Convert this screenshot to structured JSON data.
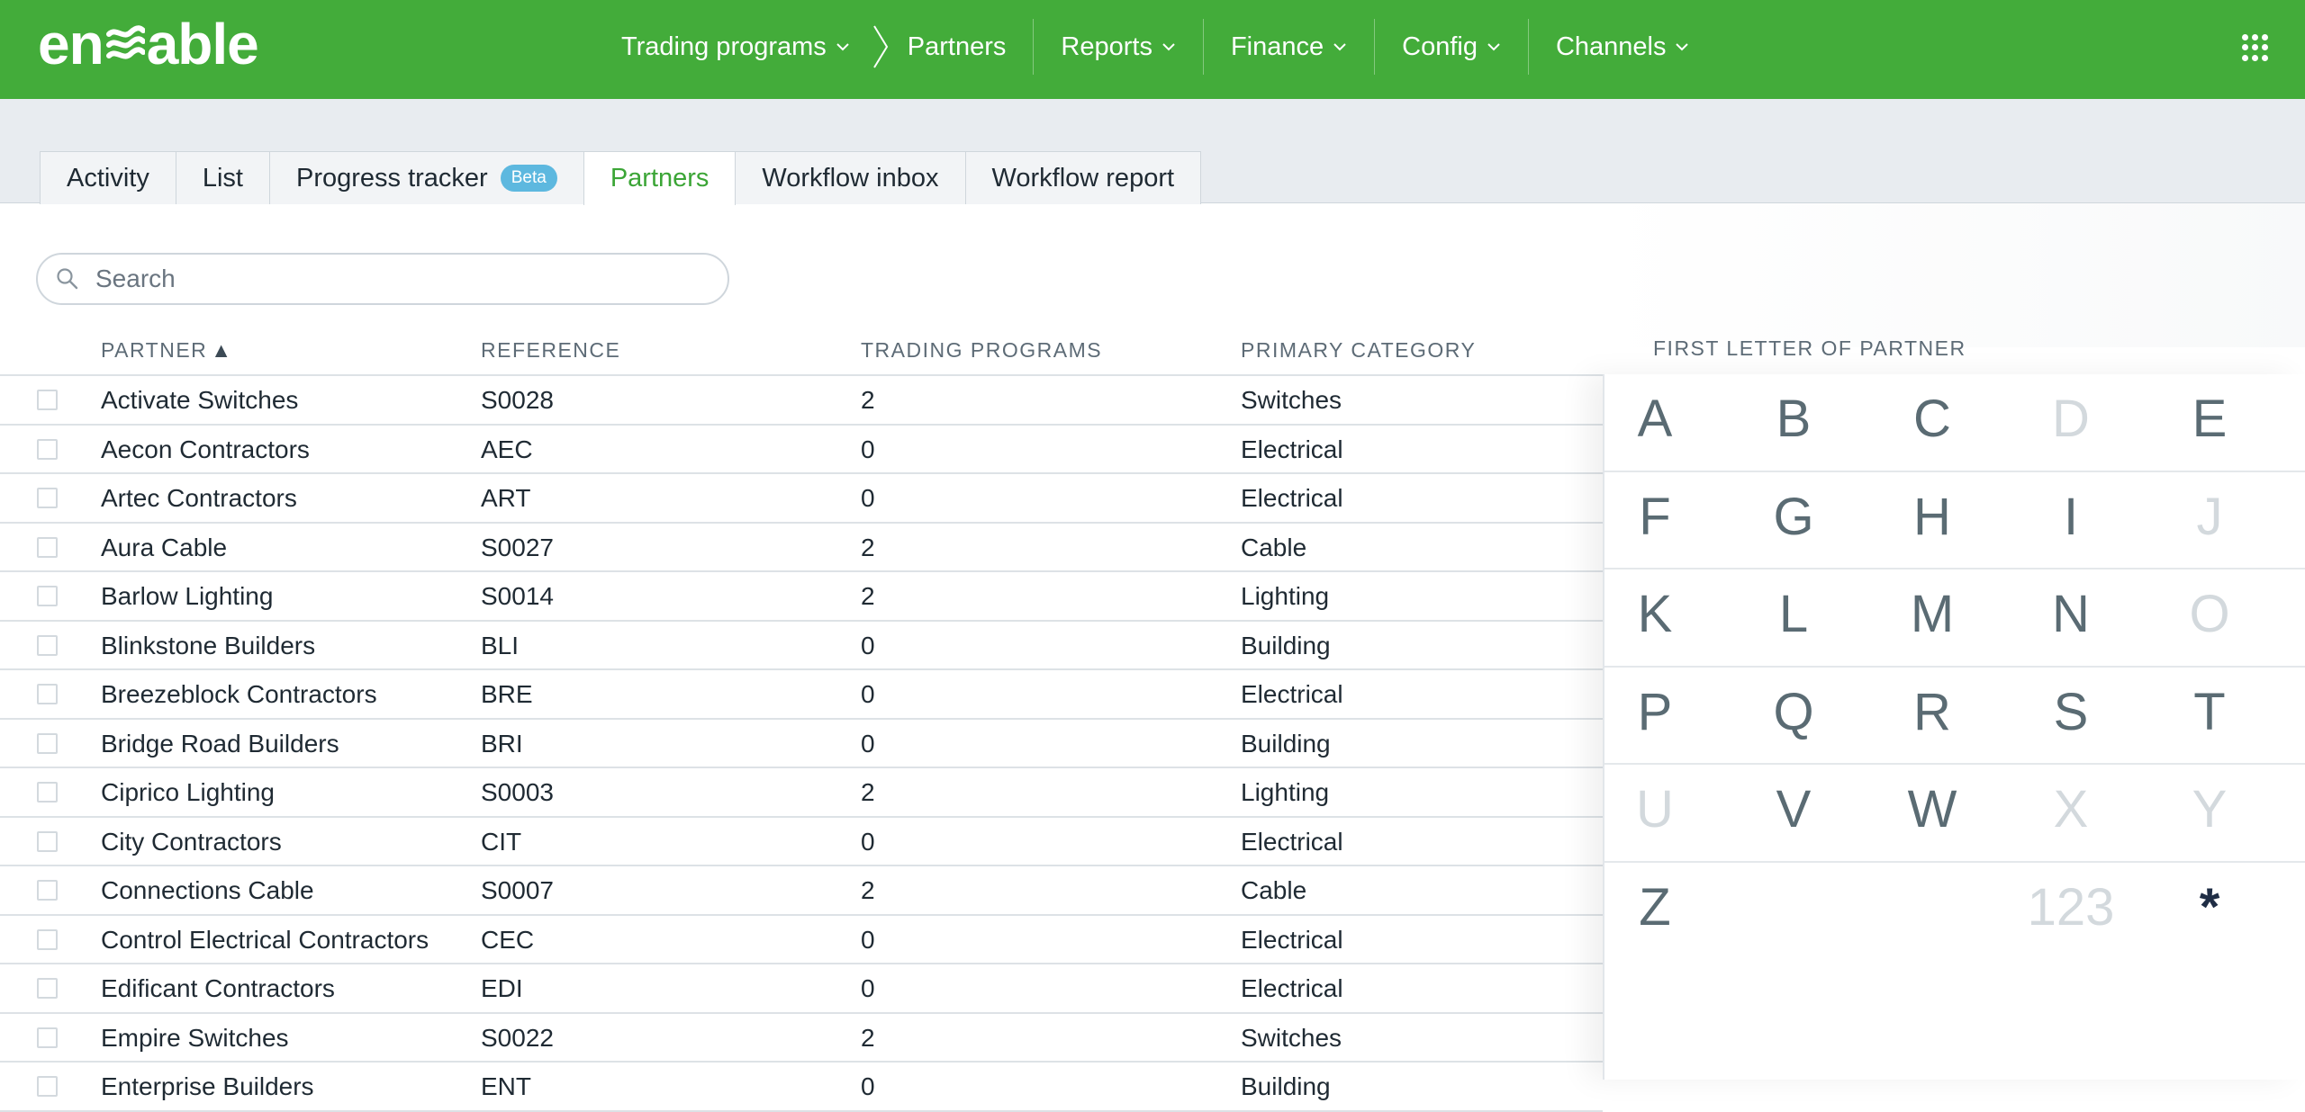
{
  "brand": {
    "logo_text_left": "en",
    "logo_text_right": "able",
    "bar_color": "#43ac3a"
  },
  "topnav": {
    "items": [
      {
        "label": "Trading programs",
        "icon": "chevron-down-icon"
      },
      {
        "label": "Partners",
        "icon": ""
      },
      {
        "label": "Reports",
        "icon": "chevron-down-icon"
      },
      {
        "label": "Finance",
        "icon": "chevron-down-icon"
      },
      {
        "label": "Config",
        "icon": "chevron-down-icon"
      },
      {
        "label": "Channels",
        "icon": "chevron-down-icon"
      }
    ],
    "apps_icon": "apps-grid-icon"
  },
  "tabs": [
    {
      "label": "Activity",
      "active": false
    },
    {
      "label": "List",
      "active": false
    },
    {
      "label": "Progress tracker",
      "badge": "Beta",
      "active": false
    },
    {
      "label": "Partners",
      "active": true
    },
    {
      "label": "Workflow inbox",
      "active": false
    },
    {
      "label": "Workflow report",
      "active": false
    }
  ],
  "search": {
    "placeholder": "Search",
    "value": "",
    "icon": "search-icon"
  },
  "table": {
    "columns": [
      "PARTNER",
      "REFERENCE",
      "TRADING PROGRAMS",
      "PRIMARY CATEGORY"
    ],
    "sort_indicator": "▲",
    "rows": [
      {
        "partner": "Activate Switches",
        "reference": "S0028",
        "programs": "2",
        "category": "Switches"
      },
      {
        "partner": "Aecon Contractors",
        "reference": "AEC",
        "programs": "0",
        "category": "Electrical"
      },
      {
        "partner": "Artec Contractors",
        "reference": "ART",
        "programs": "0",
        "category": "Electrical"
      },
      {
        "partner": "Aura Cable",
        "reference": "S0027",
        "programs": "2",
        "category": "Cable"
      },
      {
        "partner": "Barlow Lighting",
        "reference": "S0014",
        "programs": "2",
        "category": "Lighting"
      },
      {
        "partner": "Blinkstone Builders",
        "reference": "BLI",
        "programs": "0",
        "category": "Building"
      },
      {
        "partner": "Breezeblock Contractors",
        "reference": "BRE",
        "programs": "0",
        "category": "Electrical"
      },
      {
        "partner": "Bridge Road Builders",
        "reference": "BRI",
        "programs": "0",
        "category": "Building"
      },
      {
        "partner": "Ciprico Lighting",
        "reference": "S0003",
        "programs": "2",
        "category": "Lighting"
      },
      {
        "partner": "City Contractors",
        "reference": "CIT",
        "programs": "0",
        "category": "Electrical"
      },
      {
        "partner": "Connections Cable",
        "reference": "S0007",
        "programs": "2",
        "category": "Cable"
      },
      {
        "partner": "Control Electrical Contractors",
        "reference": "CEC",
        "programs": "0",
        "category": "Electrical"
      },
      {
        "partner": "Edificant Contractors",
        "reference": "EDI",
        "programs": "0",
        "category": "Electrical"
      },
      {
        "partner": "Empire Switches",
        "reference": "S0022",
        "programs": "2",
        "category": "Switches"
      },
      {
        "partner": "Enterprise Builders",
        "reference": "ENT",
        "programs": "0",
        "category": "Building"
      }
    ]
  },
  "letters": {
    "title": "FIRST LETTER OF PARTNER",
    "rows": [
      [
        {
          "l": "A",
          "on": true
        },
        {
          "l": "B",
          "on": true
        },
        {
          "l": "C",
          "on": true
        },
        {
          "l": "D",
          "on": false
        },
        {
          "l": "E",
          "on": true
        }
      ],
      [
        {
          "l": "F",
          "on": true
        },
        {
          "l": "G",
          "on": true
        },
        {
          "l": "H",
          "on": true
        },
        {
          "l": "I",
          "on": true
        },
        {
          "l": "J",
          "on": false
        }
      ],
      [
        {
          "l": "K",
          "on": true
        },
        {
          "l": "L",
          "on": true
        },
        {
          "l": "M",
          "on": true
        },
        {
          "l": "N",
          "on": true
        },
        {
          "l": "O",
          "on": false
        }
      ],
      [
        {
          "l": "P",
          "on": true
        },
        {
          "l": "Q",
          "on": true
        },
        {
          "l": "R",
          "on": true
        },
        {
          "l": "S",
          "on": true
        },
        {
          "l": "T",
          "on": true
        }
      ],
      [
        {
          "l": "U",
          "on": false
        },
        {
          "l": "V",
          "on": true
        },
        {
          "l": "W",
          "on": true
        },
        {
          "l": "X",
          "on": false
        },
        {
          "l": "Y",
          "on": false
        }
      ],
      [
        {
          "l": "Z",
          "on": true
        },
        {
          "l": "",
          "on": false
        },
        {
          "l": "",
          "on": false
        },
        {
          "l": "123",
          "on": false
        },
        {
          "l": "*",
          "on": true
        }
      ]
    ]
  }
}
